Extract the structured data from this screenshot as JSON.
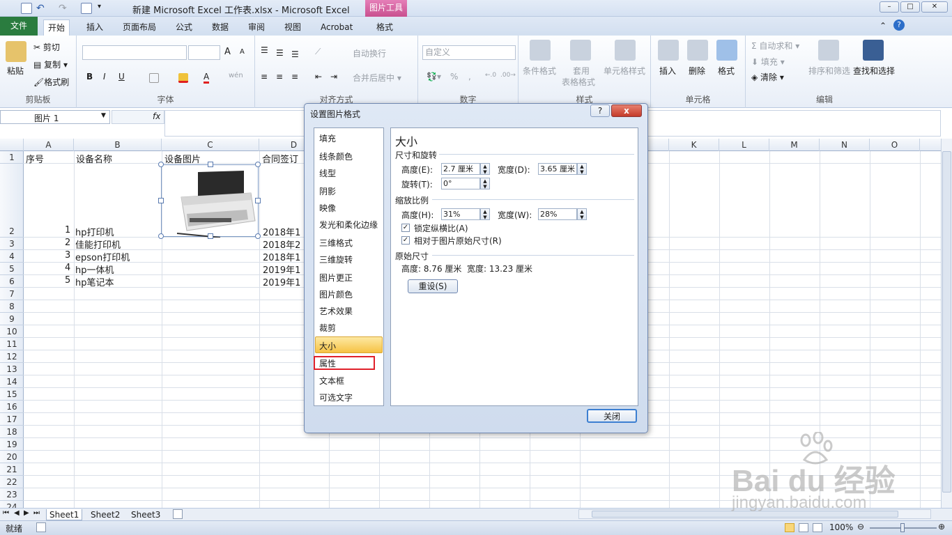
{
  "window": {
    "title": "新建 Microsoft Excel 工作表.xlsx - Microsoft Excel",
    "contextual_tab_group": "图片工具"
  },
  "tabs": [
    "文件",
    "开始",
    "插入",
    "页面布局",
    "公式",
    "数据",
    "审阅",
    "视图",
    "Acrobat",
    "格式"
  ],
  "active_tab": "开始",
  "ribbon": {
    "clipboard": {
      "label": "剪贴板",
      "paste": "粘贴",
      "cut": "剪切",
      "copy": "复制",
      "format_painter": "格式刷"
    },
    "font": {
      "label": "字体",
      "bold": "B",
      "italic": "I",
      "underline": "U",
      "grow": "A",
      "shrink": "A",
      "font_color": "A",
      "phonetic": "wén"
    },
    "alignment": {
      "label": "对齐方式",
      "wrap": "自动换行",
      "merge": "合并后居中"
    },
    "number": {
      "label": "数字",
      "format": "自定义",
      "percent": "%",
      "comma": ","
    },
    "styles": {
      "label": "样式",
      "conditional": "条件格式",
      "table_fmt_line1": "套用",
      "table_fmt_line2": "表格格式",
      "cell_styles": "单元格样式"
    },
    "cells": {
      "label": "单元格",
      "insert": "插入",
      "delete": "删除",
      "format": "格式"
    },
    "editing": {
      "label": "编辑",
      "autosum": "自动求和",
      "fill": "填充",
      "clear": "清除",
      "sort_filter": "排序和筛选",
      "find_select": "查找和选择"
    }
  },
  "formula_bar": {
    "name_box": "图片 1",
    "fx": "fx",
    "value": ""
  },
  "columns": [
    "A",
    "B",
    "C",
    "D",
    "E",
    "F",
    "G",
    "H",
    "I",
    "J",
    "K",
    "L",
    "M",
    "N",
    "O"
  ],
  "rows": [
    "1",
    "2",
    "3",
    "4",
    "5",
    "6",
    "7",
    "8",
    "9",
    "10",
    "11",
    "12",
    "13",
    "14",
    "15",
    "16",
    "17",
    "18",
    "19",
    "20",
    "21",
    "22",
    "23",
    "24"
  ],
  "sheet": {
    "headers": [
      "序号",
      "设备名称",
      "设备图片",
      "合同签订"
    ],
    "rows": [
      {
        "no": "1",
        "name": "hp打印机",
        "date": "2018年1"
      },
      {
        "no": "2",
        "name": "佳能打印机",
        "date": "2018年2"
      },
      {
        "no": "3",
        "name": "epson打印机",
        "date": "2018年1"
      },
      {
        "no": "4",
        "name": "hp一体机",
        "date": "2019年1"
      },
      {
        "no": "5",
        "name": "hp笔记本",
        "date": "2019年1"
      }
    ]
  },
  "dialog": {
    "title": "设置图片格式",
    "help": "?",
    "close_x": "x",
    "nav": [
      "填充",
      "线条颜色",
      "线型",
      "阴影",
      "映像",
      "发光和柔化边缘",
      "三维格式",
      "三维旋转",
      "图片更正",
      "图片颜色",
      "艺术效果",
      "裁剪",
      "大小",
      "属性",
      "文本框",
      "可选文字"
    ],
    "selected_nav": "大小",
    "highlighted_nav": "属性",
    "panel": {
      "heading": "大小",
      "size_rotate": "尺寸和旋转",
      "height_label": "高度(E):",
      "height_value": "2.7 厘米",
      "width_label": "宽度(D):",
      "width_value": "3.65 厘米",
      "rotate_label": "旋转(T):",
      "rotate_value": "0°",
      "scale": "缩放比例",
      "scale_h_label": "高度(H):",
      "scale_h_value": "31%",
      "scale_w_label": "宽度(W):",
      "scale_w_value": "28%",
      "lock_aspect": "锁定纵横比(A)",
      "relative_original": "相对于图片原始尺寸(R)",
      "original_size": "原始尺寸",
      "original_text": "高度: 8.76 厘米  宽度: 13.23 厘米",
      "reset": "重设(S)"
    },
    "close_button": "关闭"
  },
  "sheet_tabs": [
    "Sheet1",
    "Sheet2",
    "Sheet3"
  ],
  "status": {
    "mode": "就绪",
    "zoom": "100%"
  },
  "watermark": {
    "brand": "Bai du 经验",
    "url": "jingyan.baidu.com"
  },
  "colors": {
    "file_tab": "#2a7c3f",
    "picture_tools": "#c9508f",
    "selected_nav": "#f9c846",
    "highlight_box": "#e0202a"
  }
}
